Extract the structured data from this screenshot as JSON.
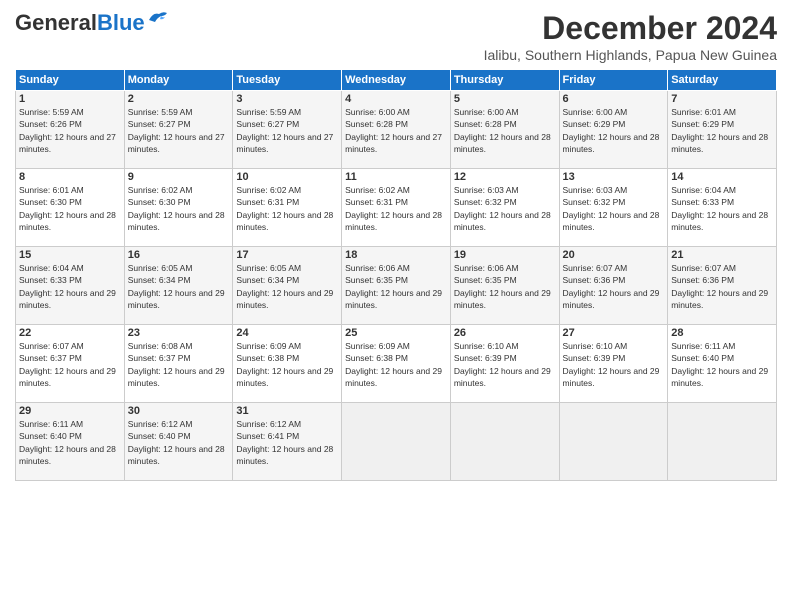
{
  "header": {
    "logo_general": "General",
    "logo_blue": "Blue",
    "month_year": "December 2024",
    "location": "Ialibu, Southern Highlands, Papua New Guinea"
  },
  "days_of_week": [
    "Sunday",
    "Monday",
    "Tuesday",
    "Wednesday",
    "Thursday",
    "Friday",
    "Saturday"
  ],
  "weeks": [
    [
      {
        "day": 1,
        "sunrise": "5:59 AM",
        "sunset": "6:26 PM",
        "daylight": "12 hours and 27 minutes"
      },
      {
        "day": 2,
        "sunrise": "5:59 AM",
        "sunset": "6:27 PM",
        "daylight": "12 hours and 27 minutes"
      },
      {
        "day": 3,
        "sunrise": "5:59 AM",
        "sunset": "6:27 PM",
        "daylight": "12 hours and 27 minutes"
      },
      {
        "day": 4,
        "sunrise": "6:00 AM",
        "sunset": "6:28 PM",
        "daylight": "12 hours and 27 minutes"
      },
      {
        "day": 5,
        "sunrise": "6:00 AM",
        "sunset": "6:28 PM",
        "daylight": "12 hours and 28 minutes"
      },
      {
        "day": 6,
        "sunrise": "6:00 AM",
        "sunset": "6:29 PM",
        "daylight": "12 hours and 28 minutes"
      },
      {
        "day": 7,
        "sunrise": "6:01 AM",
        "sunset": "6:29 PM",
        "daylight": "12 hours and 28 minutes"
      }
    ],
    [
      {
        "day": 8,
        "sunrise": "6:01 AM",
        "sunset": "6:30 PM",
        "daylight": "12 hours and 28 minutes"
      },
      {
        "day": 9,
        "sunrise": "6:02 AM",
        "sunset": "6:30 PM",
        "daylight": "12 hours and 28 minutes"
      },
      {
        "day": 10,
        "sunrise": "6:02 AM",
        "sunset": "6:31 PM",
        "daylight": "12 hours and 28 minutes"
      },
      {
        "day": 11,
        "sunrise": "6:02 AM",
        "sunset": "6:31 PM",
        "daylight": "12 hours and 28 minutes"
      },
      {
        "day": 12,
        "sunrise": "6:03 AM",
        "sunset": "6:32 PM",
        "daylight": "12 hours and 28 minutes"
      },
      {
        "day": 13,
        "sunrise": "6:03 AM",
        "sunset": "6:32 PM",
        "daylight": "12 hours and 28 minutes"
      },
      {
        "day": 14,
        "sunrise": "6:04 AM",
        "sunset": "6:33 PM",
        "daylight": "12 hours and 28 minutes"
      }
    ],
    [
      {
        "day": 15,
        "sunrise": "6:04 AM",
        "sunset": "6:33 PM",
        "daylight": "12 hours and 29 minutes"
      },
      {
        "day": 16,
        "sunrise": "6:05 AM",
        "sunset": "6:34 PM",
        "daylight": "12 hours and 29 minutes"
      },
      {
        "day": 17,
        "sunrise": "6:05 AM",
        "sunset": "6:34 PM",
        "daylight": "12 hours and 29 minutes"
      },
      {
        "day": 18,
        "sunrise": "6:06 AM",
        "sunset": "6:35 PM",
        "daylight": "12 hours and 29 minutes"
      },
      {
        "day": 19,
        "sunrise": "6:06 AM",
        "sunset": "6:35 PM",
        "daylight": "12 hours and 29 minutes"
      },
      {
        "day": 20,
        "sunrise": "6:07 AM",
        "sunset": "6:36 PM",
        "daylight": "12 hours and 29 minutes"
      },
      {
        "day": 21,
        "sunrise": "6:07 AM",
        "sunset": "6:36 PM",
        "daylight": "12 hours and 29 minutes"
      }
    ],
    [
      {
        "day": 22,
        "sunrise": "6:07 AM",
        "sunset": "6:37 PM",
        "daylight": "12 hours and 29 minutes"
      },
      {
        "day": 23,
        "sunrise": "6:08 AM",
        "sunset": "6:37 PM",
        "daylight": "12 hours and 29 minutes"
      },
      {
        "day": 24,
        "sunrise": "6:09 AM",
        "sunset": "6:38 PM",
        "daylight": "12 hours and 29 minutes"
      },
      {
        "day": 25,
        "sunrise": "6:09 AM",
        "sunset": "6:38 PM",
        "daylight": "12 hours and 29 minutes"
      },
      {
        "day": 26,
        "sunrise": "6:10 AM",
        "sunset": "6:39 PM",
        "daylight": "12 hours and 29 minutes"
      },
      {
        "day": 27,
        "sunrise": "6:10 AM",
        "sunset": "6:39 PM",
        "daylight": "12 hours and 29 minutes"
      },
      {
        "day": 28,
        "sunrise": "6:11 AM",
        "sunset": "6:40 PM",
        "daylight": "12 hours and 29 minutes"
      }
    ],
    [
      {
        "day": 29,
        "sunrise": "6:11 AM",
        "sunset": "6:40 PM",
        "daylight": "12 hours and 28 minutes"
      },
      {
        "day": 30,
        "sunrise": "6:12 AM",
        "sunset": "6:40 PM",
        "daylight": "12 hours and 28 minutes"
      },
      {
        "day": 31,
        "sunrise": "6:12 AM",
        "sunset": "6:41 PM",
        "daylight": "12 hours and 28 minutes"
      },
      null,
      null,
      null,
      null
    ]
  ]
}
